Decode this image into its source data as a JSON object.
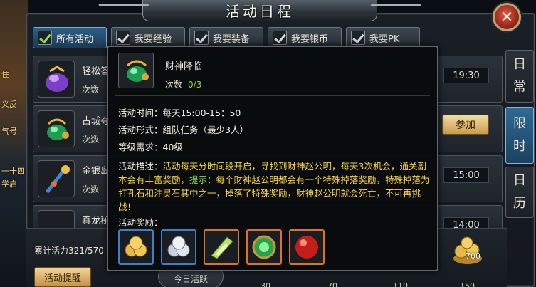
{
  "window": {
    "title": "活动日程",
    "close_glyph": "✕"
  },
  "filters": [
    {
      "label": "所有活动",
      "active": true
    },
    {
      "label": "我要经验",
      "active": false
    },
    {
      "label": "我要装备",
      "active": false
    },
    {
      "label": "我要银币",
      "active": false
    },
    {
      "label": "我要PK",
      "active": false
    }
  ],
  "activities": [
    {
      "name": "轻松答",
      "count_label": "次数",
      "time": "19:30",
      "icon": "purple-bag-icon"
    },
    {
      "name": "古城夺",
      "count_label": "次数",
      "action": "参加",
      "icon": "jade-pendant-icon"
    },
    {
      "name": "金银岛",
      "count_label": "次数",
      "time": "15:00",
      "icon": "gem-scepter-icon"
    },
    {
      "name": "真龙秘",
      "count_label": "",
      "time": "14:00",
      "icon": "dragon-icon"
    }
  ],
  "side_tabs": [
    {
      "label": "日常",
      "chars": [
        "日",
        "常"
      ],
      "active": false
    },
    {
      "label": "限时",
      "chars": [
        "限",
        "时"
      ],
      "active": true
    },
    {
      "label": "日历",
      "chars": [
        "日",
        "历"
      ],
      "active": false
    }
  ],
  "bottom": {
    "total_activity": "累计活力321/570",
    "reminder_button": "活动提醒",
    "today_button": "今日活跃",
    "scale_marks": [
      "30",
      "70",
      "110",
      "150"
    ],
    "chest_count": "700"
  },
  "tooltip": {
    "name": "财神降临",
    "count_label": "次数",
    "count_value": "0/3",
    "time_label": "活动时间：",
    "time_value": "每天15:00-15：50",
    "form_label": "活动形式：",
    "form_value": "组队任务（最少3人）",
    "level_label": "等级需求：",
    "level_value": "40级",
    "desc_label": "活动描述：",
    "desc_part1": "活动每天分时间段开启，寻找到财神赵公明，每天3次机会，通关副本会有丰富奖励，",
    "desc_hint": "提示：",
    "desc_part2": "每个财神赵公明都会有一个特殊掉落奖励，特殊掉落为打孔石和注灵石其中之一，掉落了特殊奖励，财神赵公明就会死亡，不可再挑战！",
    "reward_label": "活动奖励：",
    "rewards": [
      {
        "icon": "gold-coins-icon",
        "frame": "blue"
      },
      {
        "icon": "silver-coins-icon",
        "frame": "blue"
      },
      {
        "icon": "crystal-shard-icon",
        "frame": "orange"
      },
      {
        "icon": "green-orb-icon",
        "frame": "orange"
      },
      {
        "icon": "red-orb-icon",
        "frame": "orange"
      }
    ]
  },
  "background": {
    "npc_lines": [
      "住",
      "义反",
      "气号",
      "一十四",
      "学启"
    ]
  },
  "colors": {
    "accent_blue": "#2f6a95",
    "gold_button": "#c99c4d",
    "highlight_green": "#8bdc3c",
    "desc_yellow": "#f6d33b",
    "close_red": "#a22a1c"
  }
}
